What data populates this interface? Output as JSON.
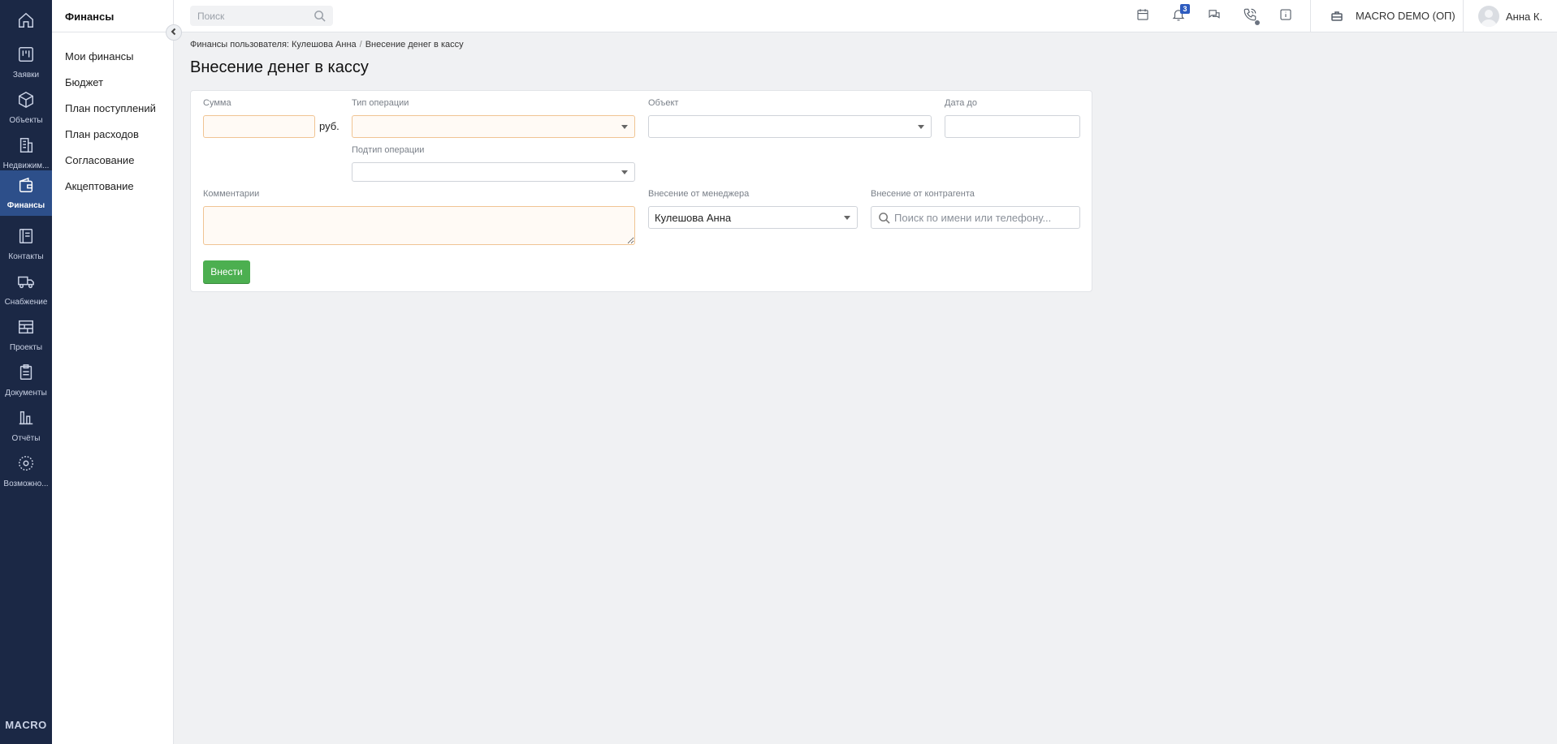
{
  "rail": {
    "items": [
      {
        "label": "",
        "icon": "home-icon"
      },
      {
        "label": "Заявки",
        "icon": "kanban-icon"
      },
      {
        "label": "Объекты",
        "icon": "cube-icon"
      },
      {
        "label": "Недвижим...",
        "icon": "building-icon"
      },
      {
        "label": "Финансы",
        "icon": "wallet-icon",
        "active": true
      },
      {
        "label": "Контакты",
        "icon": "contacts-icon"
      },
      {
        "label": "Снабжение",
        "icon": "truck-icon"
      },
      {
        "label": "Проекты",
        "icon": "projects-icon"
      },
      {
        "label": "Документы",
        "icon": "clipboard-icon"
      },
      {
        "label": "Отчёты",
        "icon": "bar-chart-icon"
      },
      {
        "label": "Возможно...",
        "icon": "gear-icon"
      }
    ],
    "logo": "MACRO"
  },
  "subnav": {
    "title": "Финансы",
    "items": [
      "Мои финансы",
      "Бюджет",
      "План поступлений",
      "План расходов",
      "Согласование",
      "Акцептование"
    ]
  },
  "topbar": {
    "search_placeholder": "Поиск",
    "notifications_count": "3",
    "company": "MACRO DEMO (ОП)",
    "user": "Анна К."
  },
  "breadcrumb": {
    "parent": "Финансы пользователя: Кулешова Анна",
    "separator": "/",
    "current": "Внесение денег в кассу"
  },
  "page": {
    "title": "Внесение денег в кассу"
  },
  "form": {
    "amount_label": "Сумма",
    "amount_value": "",
    "currency_unit": "руб.",
    "operation_type_label": "Тип операции",
    "operation_type_value": "",
    "object_label": "Объект",
    "object_value": "",
    "date_to_label": "Дата до",
    "date_to_value": "",
    "operation_subtype_label": "Подтип операции",
    "operation_subtype_value": "",
    "comment_label": "Комментарии",
    "comment_value": "",
    "manager_label": "Внесение от менеджера",
    "manager_value": "Кулешова Анна",
    "counterparty_label": "Внесение от контрагента",
    "counterparty_placeholder": "Поиск по имени или телефону...",
    "submit_label": "Внести"
  },
  "colors": {
    "rail_bg": "#1b2845",
    "rail_active": "#2d4f8a",
    "submit_green": "#4caf50",
    "required_border": "#f0c493",
    "badge_blue": "#2d5bbf"
  }
}
